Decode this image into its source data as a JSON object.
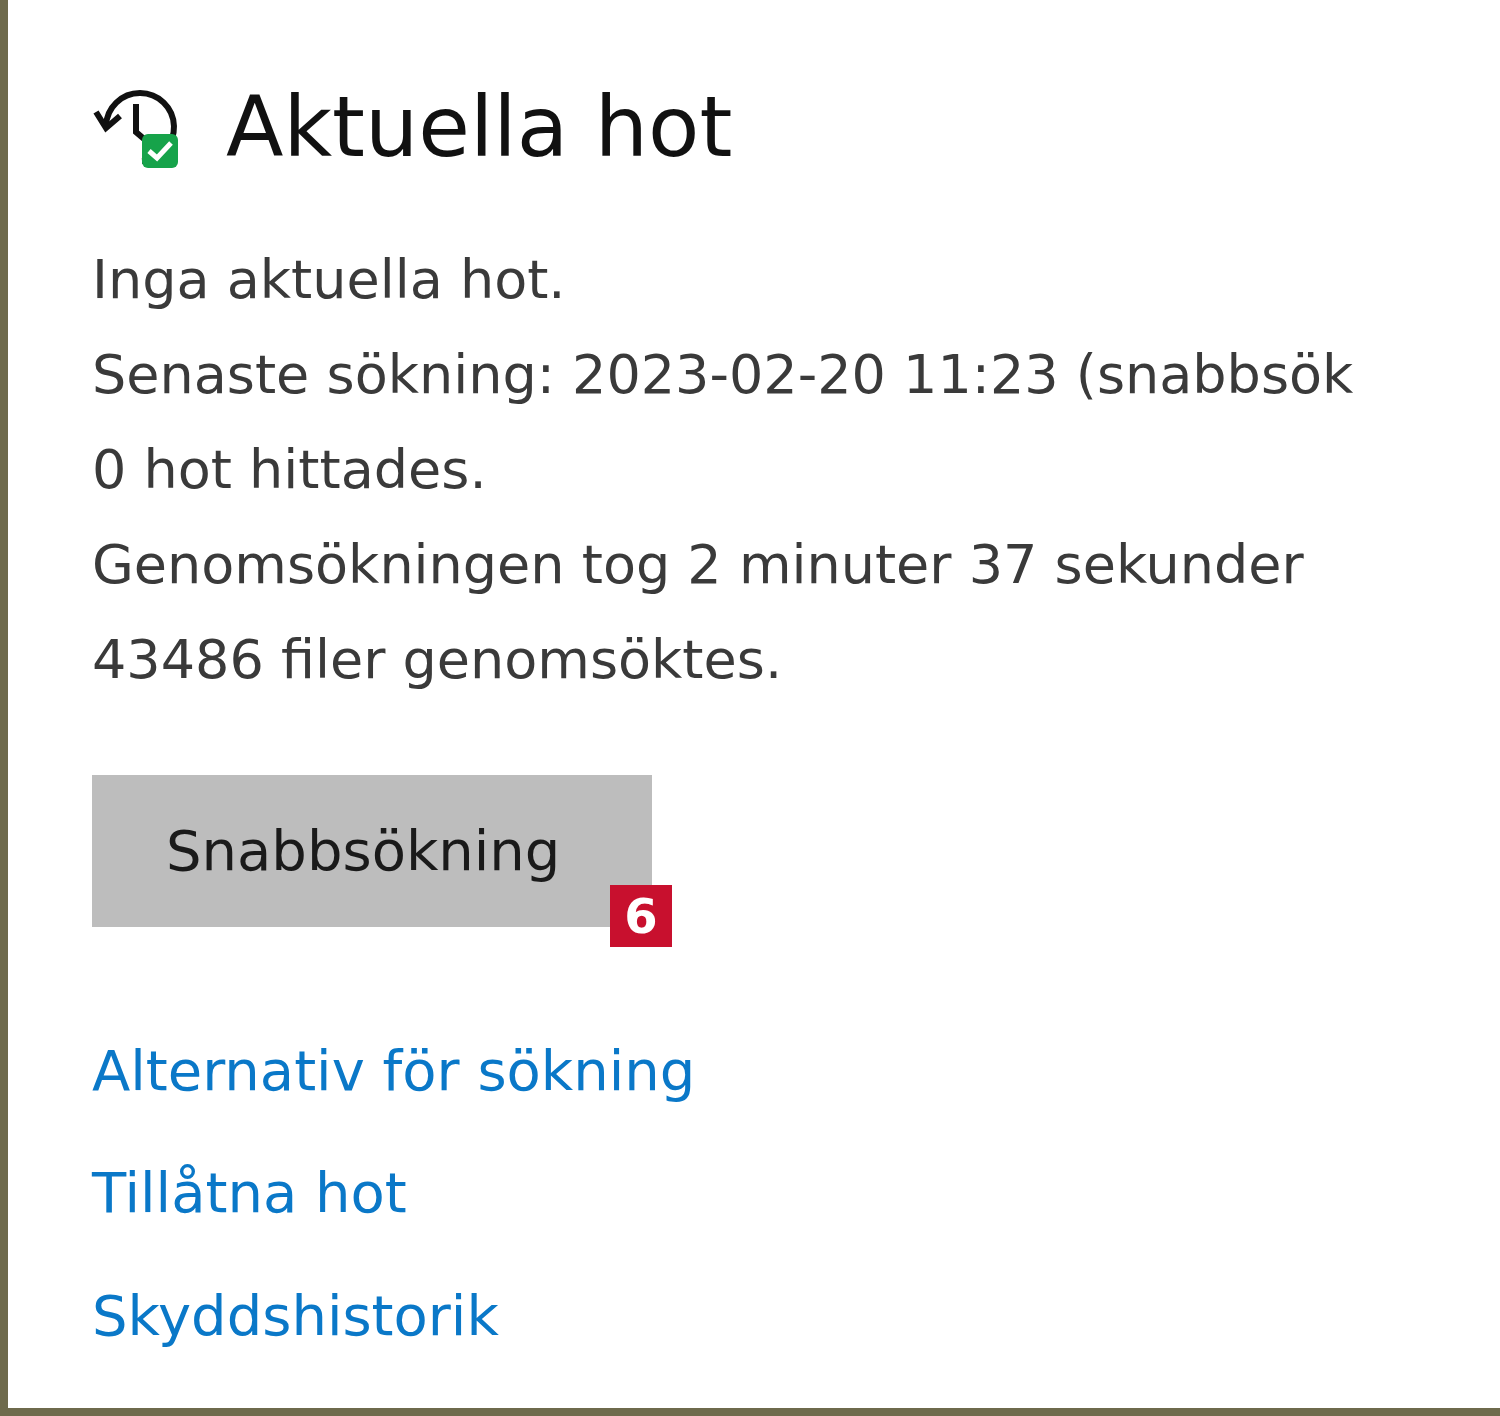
{
  "section": {
    "title": "Aktuella hot"
  },
  "status_lines": [
    "Inga aktuella hot.",
    "Senaste sökning: 2023-02-20 11:23 (snabbsök",
    "0 hot hittades.",
    "Genomsökningen tog 2 minuter 37 sekunder",
    "43486 filer genomsöktes."
  ],
  "scan_button": {
    "label": "Snabbsökning",
    "badge": "6"
  },
  "links": [
    "Alternativ för sökning",
    "Tillåtna hot",
    "Skyddshistorik"
  ]
}
